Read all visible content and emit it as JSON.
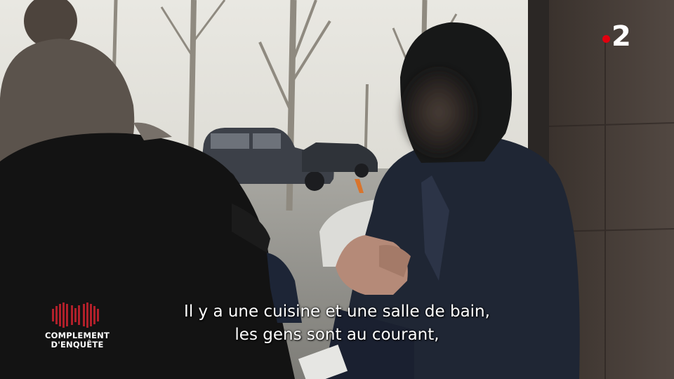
{
  "channel": {
    "logo_number": "2",
    "dot_color": "#e1000f"
  },
  "show": {
    "title_line1": "COMPLEMENT",
    "title_line2": "D'ENQUÊTE",
    "emblem_color": "#b0202a"
  },
  "subtitle": {
    "line1": "Il y a une cuisine et une salle de bain,",
    "line2": "les gens sont au courant,"
  }
}
